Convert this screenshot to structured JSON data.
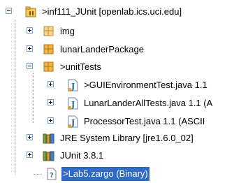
{
  "tree": {
    "project": {
      "label": ">inf111_JUnit  [openlab.ics.uci.edu]",
      "icon": "project-folder-icon",
      "expanded": true
    },
    "items": [
      {
        "label": "img",
        "icon": "package-icon",
        "expanded": false
      },
      {
        "label": "lunarLanderPackage",
        "icon": "package-icon",
        "expanded": false
      },
      {
        "label": ">unitTests",
        "icon": "package-icon",
        "expanded": true,
        "children": [
          {
            "label": ">GUIEnvironmentTest.java  1.1",
            "icon": "java-file-icon",
            "expanded": false
          },
          {
            "label": "LunarLanderAllTests.java  1.1  (A",
            "icon": "java-file-icon",
            "expanded": false
          },
          {
            "label": "ProcessorTest.java  1.1  (ASCII",
            "icon": "java-file-icon",
            "expanded": false
          }
        ]
      },
      {
        "label": "JRE System Library [jre1.6.0_02]",
        "icon": "library-icon",
        "expanded": false
      },
      {
        "label": "JUnit 3.8.1",
        "icon": "library-icon",
        "expanded": false
      },
      {
        "label": ">Lab5.zargo   (Binary)",
        "icon": "file-icon",
        "selected": true
      }
    ]
  },
  "colors": {
    "selection": "#316ac5",
    "package": "#e8a73a",
    "library": "#5a7d2a"
  }
}
